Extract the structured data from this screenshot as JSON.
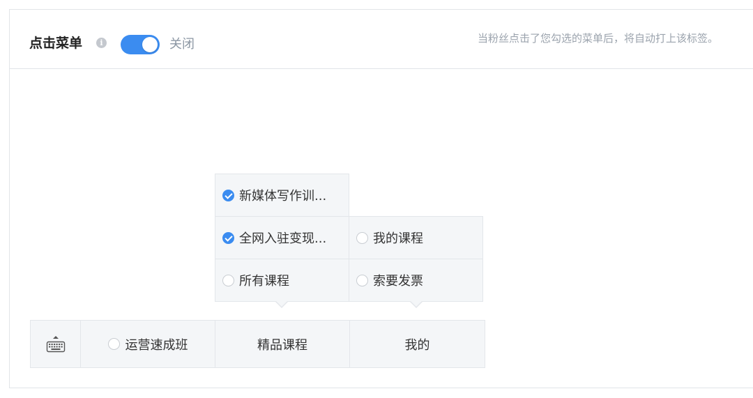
{
  "header": {
    "title": "点击菜单",
    "info_icon": "info-icon",
    "toggle_state": "on",
    "toggle_label": "关闭",
    "hint": "当粉丝点击了您勾选的菜单后，将自动打上该标签。",
    "accent_color": "#3b8cf0"
  },
  "submenus": {
    "column1": [
      {
        "label": "新媒体写作训...",
        "checked": true
      },
      {
        "label": "全网入驻变现...",
        "checked": true
      },
      {
        "label": "所有课程",
        "checked": false
      }
    ],
    "column2": [
      {
        "label": "我的课程",
        "checked": false
      },
      {
        "label": "索要发票",
        "checked": false
      }
    ]
  },
  "menubar": {
    "keyboard_icon": "keyboard-icon",
    "items": [
      {
        "label": "运营速成班",
        "has_radio": true
      },
      {
        "label": "精品课程",
        "has_radio": false
      },
      {
        "label": "我的",
        "has_radio": false
      }
    ]
  }
}
